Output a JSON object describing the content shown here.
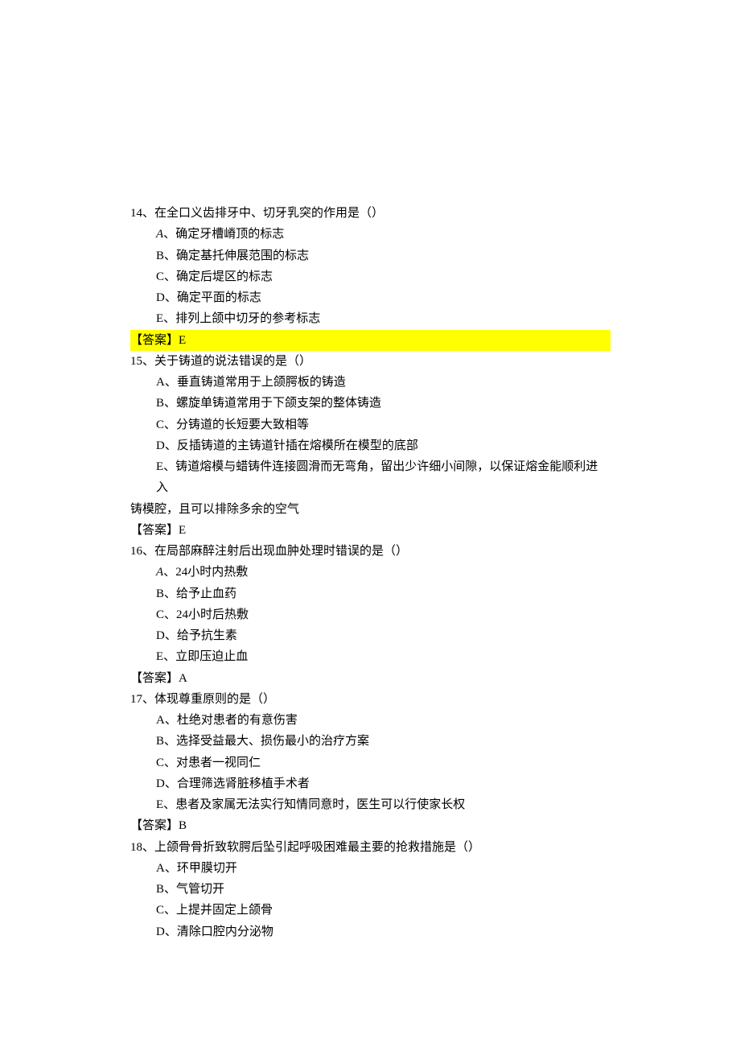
{
  "answer_prefix": "【答案】",
  "option_sep": "、",
  "questions": [
    {
      "num": "14",
      "stem": "在全口义齿排牙中、切牙乳突的作用是（）",
      "options": [
        {
          "label": "A",
          "italicLabel": true,
          "text": "确定牙槽嵴顶的标志"
        },
        {
          "label": "B",
          "text": "确定基托伸展范围的标志"
        },
        {
          "label": "C",
          "text": "确定后堤区的标志"
        },
        {
          "label": "D",
          "text": "确定平面的标志"
        },
        {
          "label": "E",
          "text": "排列上颌中切牙的参考标志"
        }
      ],
      "answer": "E",
      "answer_highlight": true
    },
    {
      "num": "15",
      "stem": "关于铸道的说法错误的是（）",
      "options": [
        {
          "label": "A",
          "text": "垂直铸道常用于上颌腭板的铸造"
        },
        {
          "label": "B",
          "text": "螺旋单铸道常用于下颌支架的整体铸造"
        },
        {
          "label": "C",
          "text": "分铸道的长短要大致相等"
        },
        {
          "label": "D",
          "text": "反插铸道的主铸道针插在熔模所在模型的底部"
        },
        {
          "label": "E",
          "text": "铸道熔模与蜡铸件连接圆滑而无弯角，留出少许细小间隙，以保证熔金能顺利进入",
          "cont": "铸模腔，且可以排除多余的空气"
        }
      ],
      "answer": "E"
    },
    {
      "num": "16",
      "stem": "在局部麻醉注射后出现血肿处理时错误的是（）",
      "options": [
        {
          "label": "A",
          "italicLabel": true,
          "text": "24小时内热敷"
        },
        {
          "label": "B",
          "text": "给予止血药"
        },
        {
          "label": "C",
          "text": "24小时后热敷"
        },
        {
          "label": "D",
          "text": "给予抗生素"
        },
        {
          "label": "E",
          "text": "立即压迫止血"
        }
      ],
      "answer": "A"
    },
    {
      "num": "17",
      "stem": "体现尊重原则的是（）",
      "options": [
        {
          "label": "A",
          "text": "杜绝对患者的有意伤害"
        },
        {
          "label": "B",
          "text": "选择受益最大、损伤最小的治疗方案"
        },
        {
          "label": "C",
          "text": "对患者一视同仁"
        },
        {
          "label": "D",
          "text": "合理筛选肾脏移植手术者"
        },
        {
          "label": "E",
          "text": "患者及家属无法实行知情同意时，医生可以行使家长权"
        }
      ],
      "answer": "B"
    },
    {
      "num": "18",
      "stem": "上颌骨骨折致软腭后坠引起呼吸困难最主要的抢救措施是（）",
      "options": [
        {
          "label": "A",
          "text": "环甲膜切开"
        },
        {
          "label": "B",
          "text": "气管切开"
        },
        {
          "label": "C",
          "text": "上提并固定上颌骨"
        },
        {
          "label": "D",
          "text": "清除口腔内分泌物"
        }
      ]
    }
  ]
}
